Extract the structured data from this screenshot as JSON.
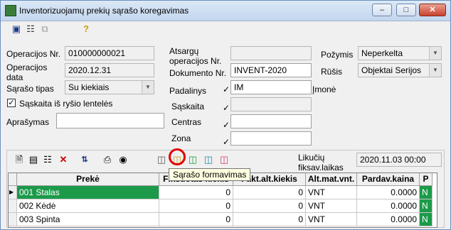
{
  "window": {
    "title": "Inventorizuojamų prekių sąrašo koregavimas"
  },
  "form": {
    "op_nr_label": "Operacijos Nr.",
    "op_nr_value": "010000000021",
    "op_date_label": "Operacijos data",
    "op_date_value": "2020.12.31",
    "list_type_label": "Sąrašo tipas",
    "list_type_value": "Su kiekiais",
    "account_from_table_label": "Sąskaita iš ryšio lentelės",
    "description_label": "Aprašymas",
    "description_value": "",
    "spare_op_label": "Atsargų operacijos Nr.",
    "spare_op_value": "",
    "document_nr_label": "Dokumento Nr.",
    "document_nr_value": "INVENT-2020",
    "department_label": "Padalinys",
    "department_value": "IM",
    "company_label": "Įmonė",
    "account_label": "Sąskaita",
    "center_label": "Centras",
    "zone_label": "Zona",
    "feature_label": "Požymis",
    "feature_value": "Neperkelta",
    "kind_label": "Rūšis",
    "kind_value": "Objektai Serijos",
    "check_mark": "✓"
  },
  "grid_toolbar": {
    "balances_label": "Likučių fiksav.laikas",
    "balances_value": "2020.11.03 00:00",
    "tooltip": "Sąrašo formavimas"
  },
  "grid": {
    "columns": [
      "Prekė",
      "Fiksuotas kiekis",
      "Fakt.alt.kiekis",
      "Alt.mat.vnt.",
      "Pardav.kaina",
      "P"
    ],
    "rows": [
      {
        "item": "001  Stalas",
        "fixed": "0",
        "fact": "0",
        "unit": "VNT",
        "price": "0.0000",
        "p": "N"
      },
      {
        "item": "002  Kėdė",
        "fixed": "0",
        "fact": "0",
        "unit": "VNT",
        "price": "0.0000",
        "p": "N"
      },
      {
        "item": "003  Spinta",
        "fixed": "0",
        "fact": "0",
        "unit": "VNT",
        "price": "0.0000",
        "p": "N"
      }
    ]
  }
}
